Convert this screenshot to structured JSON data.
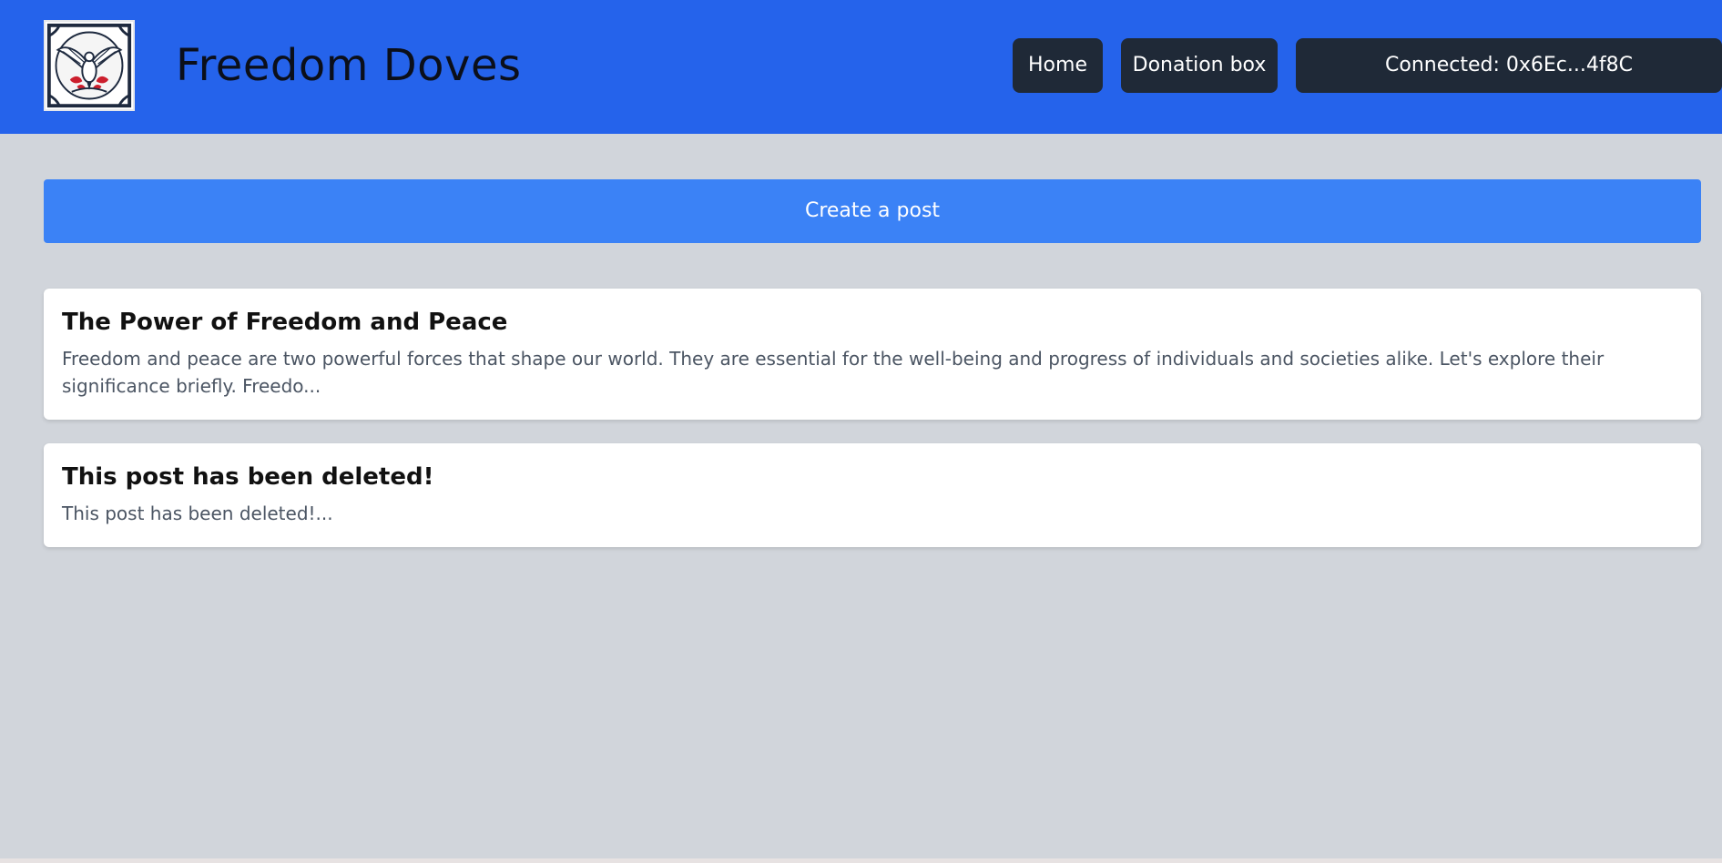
{
  "app": {
    "title": "Freedom Doves"
  },
  "nav": {
    "home_label": "Home",
    "donation_label": "Donation box",
    "wallet_label": "Connected: 0x6Ec...4f8C"
  },
  "actions": {
    "create_post_label": "Create a post"
  },
  "posts": [
    {
      "title": "The Power of Freedom and Peace",
      "excerpt": "Freedom and peace are two powerful forces that shape our world. They are essential for the well-being and progress of individuals and societies alike. Let's explore their significance briefly. Freedo..."
    },
    {
      "title": "This post has been deleted!",
      "excerpt": "This post has been deleted!..."
    }
  ],
  "icons": {
    "logo": "dove-emblem-icon"
  },
  "colors": {
    "header_bg": "#2563eb",
    "nav_button_bg": "#1f2937",
    "create_button_bg": "#3b82f6",
    "page_bg": "#d1d5db",
    "card_bg": "#ffffff",
    "excerpt_text": "#4b5563"
  }
}
